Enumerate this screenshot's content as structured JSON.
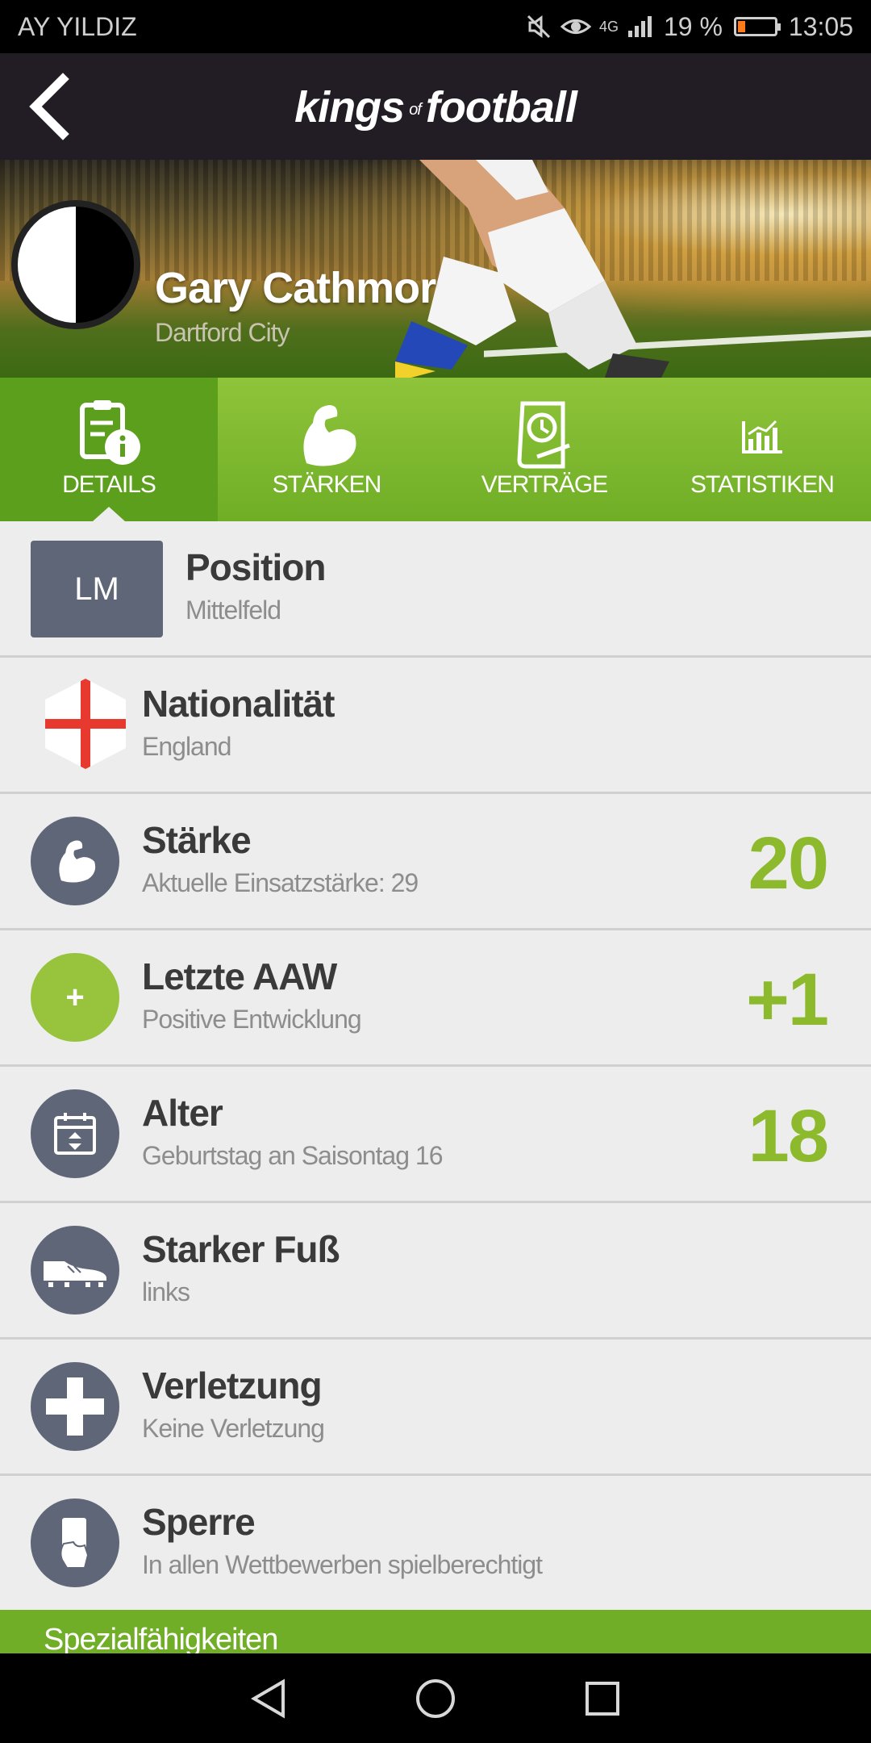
{
  "status_bar": {
    "carrier": "AY YILDIZ",
    "network": "4G",
    "battery": "19 %",
    "battery_level": 0.19,
    "time": "13:05"
  },
  "header": {
    "logo_primary": "kings",
    "logo_of": "of",
    "logo_secondary": "football"
  },
  "player": {
    "name": "Gary Cathmor",
    "club": "Dartford City"
  },
  "tabs": [
    {
      "label": "DETAILS",
      "icon": "info-document-icon",
      "active": true
    },
    {
      "label": "STÄRKEN",
      "icon": "flexed-arm-icon",
      "active": false
    },
    {
      "label": "VERTRÄGE",
      "icon": "contract-clock-icon",
      "active": false
    },
    {
      "label": "STATISTIKEN",
      "icon": "bar-chart-icon",
      "active": false
    }
  ],
  "details": {
    "position": {
      "badge": "LM",
      "title": "Position",
      "subtitle": "Mittelfeld"
    },
    "nationality": {
      "title": "Nationalität",
      "subtitle": "England",
      "icon": "england-flag-icon"
    },
    "strength": {
      "title": "Stärke",
      "subtitle": "Aktuelle Einsatzstärke: 29",
      "value": "20",
      "icon": "flexed-arm-icon"
    },
    "last_aaw": {
      "title": "Letzte AAW",
      "subtitle": "Positive Entwicklung",
      "value": "+1",
      "icon_glyph": "+"
    },
    "age": {
      "title": "Alter",
      "subtitle": "Geburtstag an Saisontag 16",
      "value": "18",
      "icon": "calendar-icon"
    },
    "strong_foot": {
      "title": "Starker Fuß",
      "subtitle": "links",
      "icon": "football-boot-icon"
    },
    "injury": {
      "title": "Verletzung",
      "subtitle": "Keine Verletzung",
      "icon": "medical-cross-icon"
    },
    "suspension": {
      "title": "Sperre",
      "subtitle": "In allen Wettbewerben spielberechtigt",
      "icon": "card-hand-icon"
    }
  },
  "special_section": {
    "label": "Spezialfähigkeiten"
  },
  "colors": {
    "accent_green": "#8dba2c",
    "header_dark": "#221c24",
    "icon_slate": "#5f6677"
  }
}
